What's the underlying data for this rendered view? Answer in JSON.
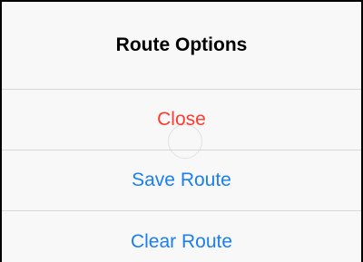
{
  "sheet": {
    "title": "Route Options",
    "actions": [
      {
        "label": "Close",
        "color": "#ff3b30"
      },
      {
        "label": "Save Route",
        "color": "#1a7ff0"
      },
      {
        "label": "Clear Route",
        "color": "#1a7ff0"
      }
    ]
  }
}
